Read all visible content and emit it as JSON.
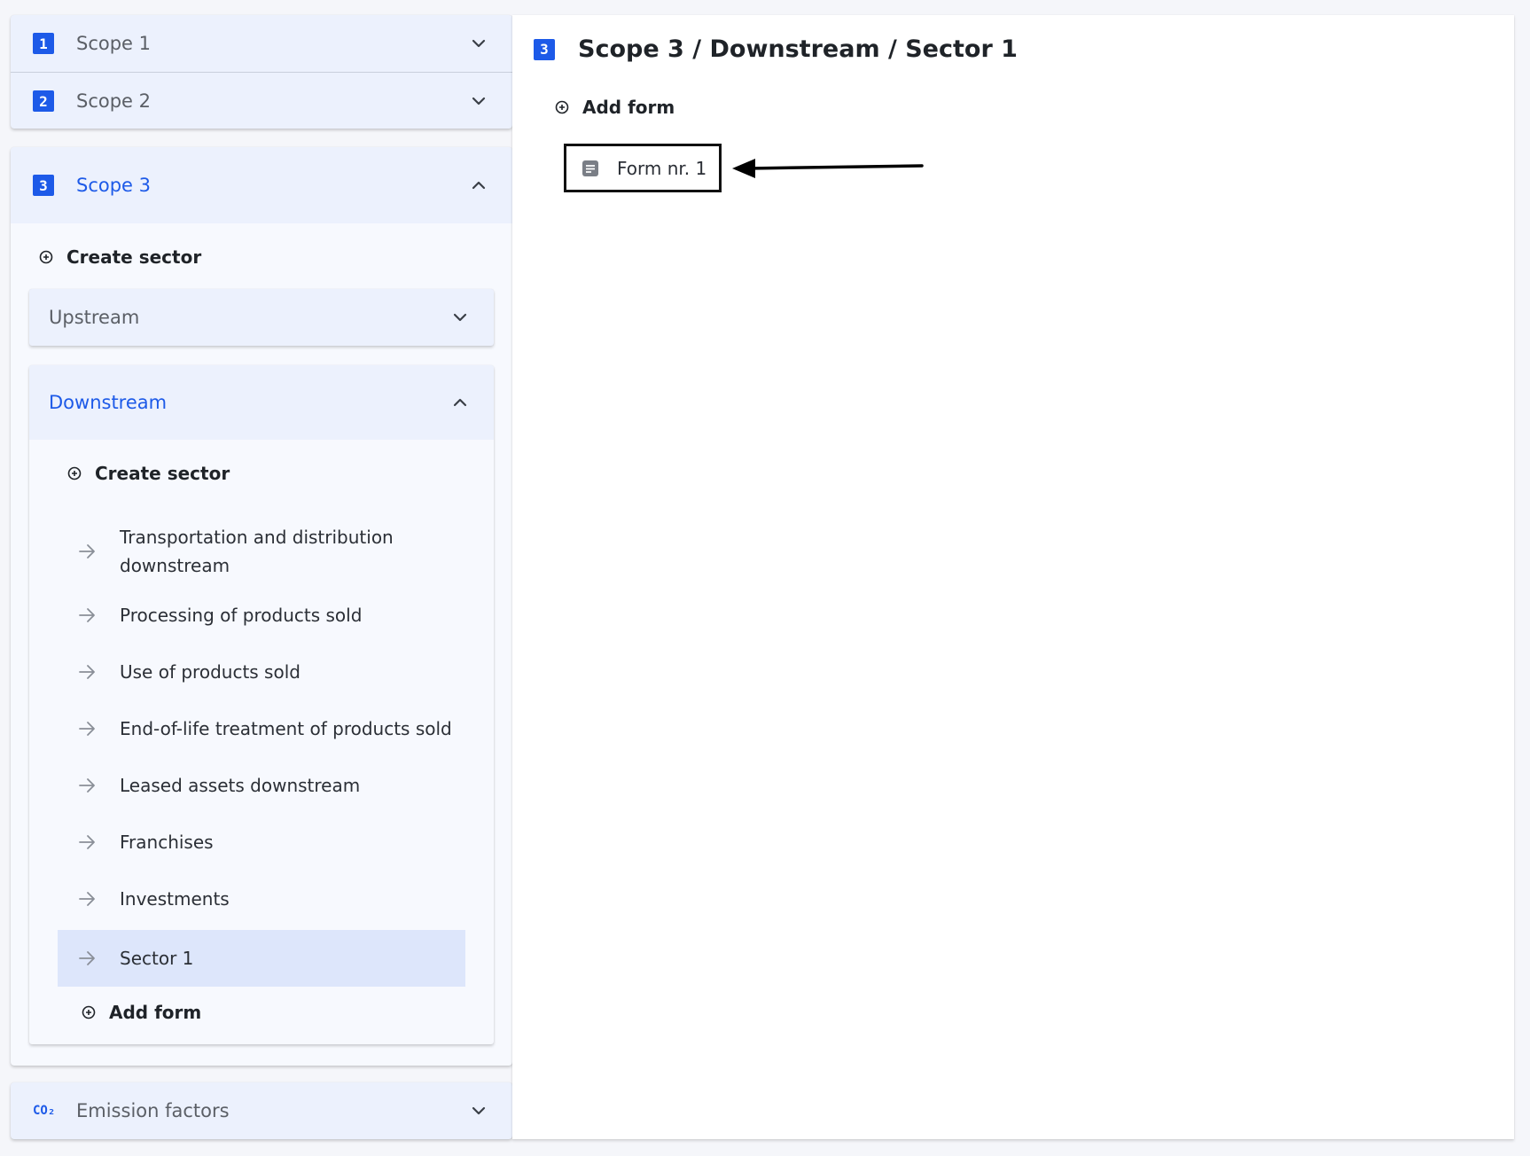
{
  "sidebar": {
    "scope1": {
      "badge": "1",
      "title": "Scope 1"
    },
    "scope2": {
      "badge": "2",
      "title": "Scope 2"
    },
    "scope3": {
      "badge": "3",
      "title": "Scope 3",
      "create_sector": "Create sector",
      "upstream": {
        "title": "Upstream"
      },
      "downstream": {
        "title": "Downstream",
        "create_sector": "Create sector",
        "items": [
          "Transportation and distribution downstream",
          "Processing of products sold",
          "Use of products sold",
          "End-of-life treatment of products sold",
          "Leased assets downstream",
          "Franchises",
          "Investments",
          "Sector 1"
        ],
        "add_form": "Add form"
      }
    },
    "emission_factors": {
      "badge": "CO₂",
      "title": "Emission factors"
    }
  },
  "main": {
    "badge": "3",
    "title": "Scope 3 / Downstream / Sector 1",
    "add_form": "Add form",
    "forms": [
      "Form nr. 1"
    ]
  },
  "colors": {
    "accent": "#1d5ae8",
    "selected_row": "#dde6fb",
    "panel_bg": "#ecf1fd"
  }
}
